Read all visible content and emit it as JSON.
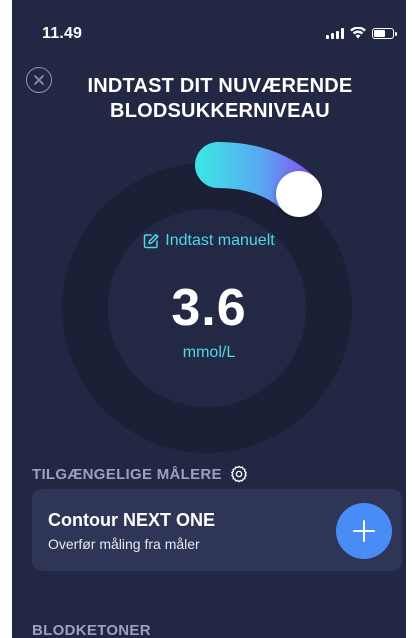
{
  "status_bar": {
    "time": "11.49"
  },
  "header": {
    "title_line1": "INDTAST DIT NUVÆRENDE",
    "title_line2": "BLODSUKKERNIVEAU"
  },
  "dial": {
    "manual_label": "Indtast manuelt",
    "value": "3.6",
    "unit": "mmol/L"
  },
  "meters": {
    "section_title": "TILGÆNGELIGE MÅLERE",
    "items": [
      {
        "name": "Contour NEXT ONE",
        "subtitle": "Overfør måling fra måler"
      }
    ]
  },
  "ketones": {
    "section_title": "BLODKETONER"
  },
  "colors": {
    "background": "#222843",
    "accent": "#4fd8e6",
    "button": "#4a8cf6",
    "arc_start": "#3de3e6",
    "arc_end": "#8a4ff0"
  },
  "icons": [
    "close-icon",
    "edit-icon",
    "gear-icon",
    "plus-icon"
  ]
}
